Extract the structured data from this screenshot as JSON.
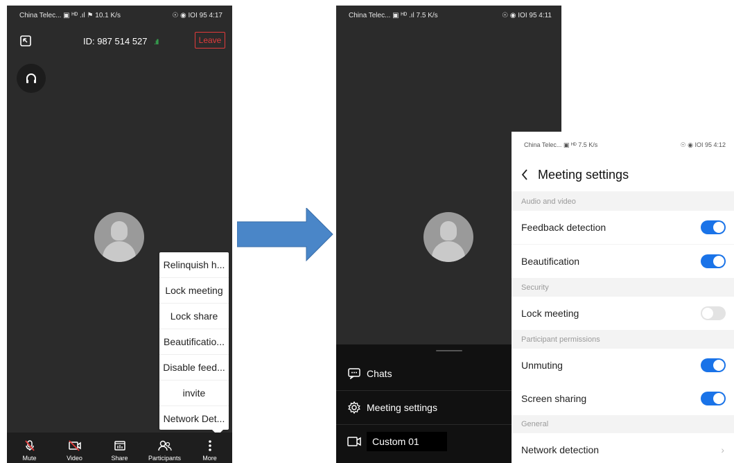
{
  "left_phone": {
    "status_left": "China Telec... ▣ ᴴᴰ .ıl ⚑ 10.1 K/s",
    "status_right": "☉ ◉ IOI 95 4:17",
    "meeting_id": "ID: 987 514 527",
    "signal": ".ıll",
    "leave_label": "Leave",
    "more_menu": [
      "Relinquish h...",
      "Lock meeting",
      "Lock share",
      "Beautificatio...",
      "Disable feed...",
      "invite",
      "Network Det..."
    ],
    "toolbar": {
      "mute": "Mute",
      "video": "Video",
      "share": "Share",
      "participants": "Participants",
      "more": "More"
    }
  },
  "mid_phone": {
    "status_left": "China Telec... ▣ ᴴᴰ .ıl 7.5 K/s",
    "status_right": "☉ ◉ IOI 95 4:11",
    "sheet": {
      "chats": "Chats",
      "meeting_settings": "Meeting settings",
      "custom": "Custom 01"
    }
  },
  "settings_panel": {
    "status_left": "China Telec... ▣ ᴴᴰ 7.5 K/s",
    "status_right": "☉ ◉ IOI 95 4:12",
    "title": "Meeting settings",
    "sections": {
      "audio_video": "Audio and video",
      "security": "Security",
      "participant_permissions": "Participant permissions",
      "general": "General"
    },
    "rows": {
      "feedback_detection": "Feedback detection",
      "beautification": "Beautification",
      "lock_meeting": "Lock meeting",
      "unmuting": "Unmuting",
      "screen_sharing": "Screen sharing",
      "network_detection": "Network detection"
    },
    "toggles": {
      "feedback_detection": true,
      "beautification": true,
      "lock_meeting": false,
      "unmuting": true,
      "screen_sharing": true
    }
  },
  "colors": {
    "accent": "#1a73e8",
    "leave": "#e23b3b",
    "arrow": "#4a86c8",
    "meeting_bg": "#2b2b2b"
  }
}
